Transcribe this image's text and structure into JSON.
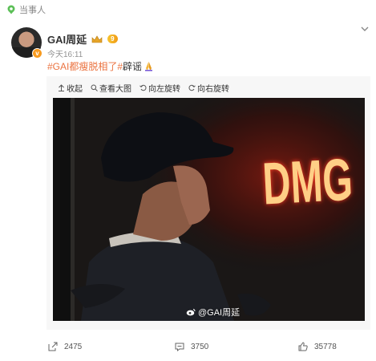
{
  "top_tag": {
    "label": "当事人",
    "icon": "location-pin-icon"
  },
  "post": {
    "author": "GAI周延",
    "level_badge": "9",
    "time": "今天16:11",
    "text": {
      "hashtag1": "#GAI都瘦脱相了#",
      "plain": "辟谣",
      "emoji": "praying-hands-icon"
    }
  },
  "toolbar": {
    "collapse": "收起",
    "view_large": "查看大图",
    "rotate_left": "向左旋转",
    "rotate_right": "向右旋转"
  },
  "photo": {
    "sign_text": "DMG",
    "watermark": "@GAI周延"
  },
  "stats": {
    "repost": "2475",
    "comment": "3750",
    "like": "35778"
  },
  "colors": {
    "hashtag": "#eb7340",
    "neon": "#ff3a22",
    "card_bg": "#f7f7f7"
  }
}
